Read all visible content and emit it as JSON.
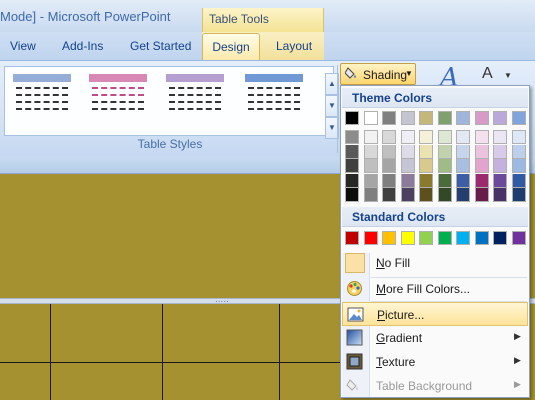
{
  "window": {
    "title": "Mode] - Microsoft PowerPoint",
    "context_label": "Table Tools"
  },
  "tabs": [
    {
      "label": "View"
    },
    {
      "label": "Add-Ins"
    },
    {
      "label": "Get Started"
    },
    {
      "label": "Design"
    },
    {
      "label": "Layout"
    }
  ],
  "ribbon": {
    "table_styles_group_label": "Table Styles",
    "table_styles": [
      {
        "header_color": "#95aed8",
        "line_color": "#333333"
      },
      {
        "header_color": "#d788b5",
        "line_color": "#333333"
      },
      {
        "header_color": "#b49fd0",
        "line_color": "#333333"
      },
      {
        "header_color": "#6f98d5",
        "line_color": "#333333"
      }
    ],
    "shading_button_label": "Shading",
    "wordart_glyph": "A"
  },
  "shading_menu": {
    "theme_colors_header": "Theme Colors",
    "theme_top_row": [
      "#000000",
      "#ffffff",
      "#7f7f7f",
      "#c5c5d0",
      "#c4b777",
      "#7fa06f",
      "#9fb5db",
      "#d79bc7",
      "#b9a8d9",
      "#7fa5dc"
    ],
    "theme_shade_rows": [
      [
        "#8c8c8c",
        "#f2f2f2",
        "#d8d8d8",
        "#eeeef4",
        "#f5f0d8",
        "#dde8d3",
        "#e2e9f5",
        "#f5e1ee",
        "#ebe5f4",
        "#dde7f5"
      ],
      [
        "#595959",
        "#d8d8d8",
        "#bfbfbf",
        "#dcdce8",
        "#ebe2b2",
        "#c0d3ad",
        "#c6d4ec",
        "#ebc3de",
        "#d7cbe9",
        "#bcd0ec"
      ],
      [
        "#3f3f3f",
        "#bfbfbf",
        "#a5a5a5",
        "#c5c5d6",
        "#d9c98a",
        "#9fbb86",
        "#a8bfe1",
        "#e1a5cd",
        "#c4b1de",
        "#9bb9e2"
      ],
      [
        "#262626",
        "#a5a5a5",
        "#7f7f7f",
        "#8c7a9a",
        "#8a7a2e",
        "#4c6b3b",
        "#3b5ea6",
        "#9b2b6f",
        "#6b4a9b",
        "#2e5aa6"
      ],
      [
        "#0c0c0c",
        "#7f7f7f",
        "#3f3f3f",
        "#4c3f5f",
        "#5c501c",
        "#324827",
        "#243e6f",
        "#671c4a",
        "#473167",
        "#1e3c6f"
      ]
    ],
    "standard_colors_header": "Standard Colors",
    "standard_colors": [
      "#c00000",
      "#ff0000",
      "#ffc000",
      "#ffff00",
      "#92d050",
      "#00b050",
      "#00b0f0",
      "#0070c0",
      "#002060",
      "#7030a0"
    ],
    "items": {
      "no_fill": {
        "label_access": "N",
        "label_rest": "o Fill"
      },
      "more_fill_colors": {
        "label_access": "M",
        "label_rest": "ore Fill Colors..."
      },
      "picture": {
        "label_access": "P",
        "label_rest": "icture..."
      },
      "gradient": {
        "label_access": "G",
        "label_rest": "radient"
      },
      "texture": {
        "label_access": "T",
        "label_rest": "exture"
      },
      "table_background": {
        "label_access": "",
        "label_rest": "Table Background"
      }
    }
  }
}
